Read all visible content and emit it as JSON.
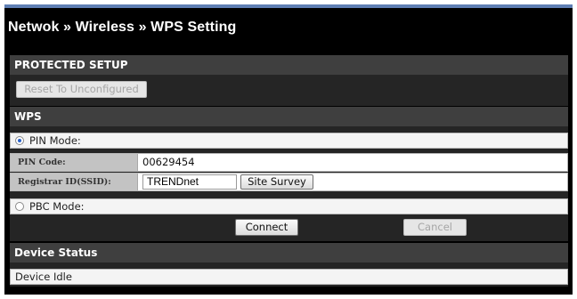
{
  "header": {
    "title": "Netwok » Wireless » WPS Setting"
  },
  "protected_setup": {
    "title": "PROTECTED SETUP",
    "reset_button": "Reset To Unconfigured"
  },
  "wps": {
    "title": "WPS",
    "pin_mode": {
      "label": "PIN Mode:",
      "selected": true
    },
    "pin_code": {
      "label": "PIN Code:",
      "value": "00629454"
    },
    "registrar": {
      "label": "Registrar ID(SSID):",
      "value": "TRENDnet",
      "site_survey_button": "Site Survey"
    },
    "pbc_mode": {
      "label": "PBC Mode:",
      "selected": false
    },
    "connect_button": "Connect",
    "cancel_button": "Cancel"
  },
  "device_status": {
    "title": "Device Status",
    "value": "Device Idle"
  }
}
